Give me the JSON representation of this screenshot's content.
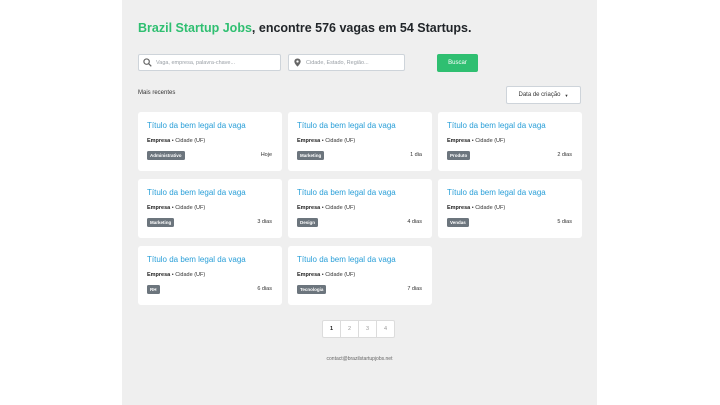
{
  "header": {
    "brand": "Brazil Startup Jobs",
    "tagline": ", encontre 576 vagas em 54 Startups."
  },
  "search": {
    "keyword_placeholder": "Vaga, empresa, palavra-chave...",
    "keyword_value": "",
    "location_placeholder": "Cidade, Estado, Região...",
    "location_value": "",
    "button_label": "Buscar"
  },
  "listing": {
    "section_label": "Mais recentes",
    "sort_label": "Data de criação",
    "jobs": [
      {
        "title": "Título da bem legal da vaga",
        "company": "Empresa",
        "location": " • Cidade (UF)",
        "tag": "Administrativo",
        "posted": "Hoje"
      },
      {
        "title": "Título da bem legal da vaga",
        "company": "Empresa",
        "location": " • Cidade (UF)",
        "tag": "Marketing",
        "posted": "1 dia"
      },
      {
        "title": "Título da bem legal da vaga",
        "company": "Empresa",
        "location": " • Cidade (UF)",
        "tag": "Produto",
        "posted": "2 dias"
      },
      {
        "title": "Título da bem legal da vaga",
        "company": "Empresa",
        "location": " • Cidade (UF)",
        "tag": "Marketing",
        "posted": "3 dias"
      },
      {
        "title": "Título da bem legal da vaga",
        "company": "Empresa",
        "location": " • Cidade (UF)",
        "tag": "Design",
        "posted": "4 dias"
      },
      {
        "title": "Título da bem legal da vaga",
        "company": "Empresa",
        "location": " • Cidade (UF)",
        "tag": "Vendas",
        "posted": "5 dias"
      },
      {
        "title": "Título da bem legal da vaga",
        "company": "Empresa",
        "location": " • Cidade (UF)",
        "tag": "RH",
        "posted": "6 dias"
      },
      {
        "title": "Título da bem legal da vaga",
        "company": "Empresa",
        "location": " • Cidade (UF)",
        "tag": "Tecnologia",
        "posted": "7 dias"
      }
    ]
  },
  "pagination": {
    "pages": [
      "1",
      "2",
      "3",
      "4"
    ],
    "current": "1"
  },
  "footer": {
    "email": "contact@brazilstartupjobs.net"
  },
  "colors": {
    "brand": "#2fbf71",
    "link": "#2a9fd8",
    "tag_bg": "#6c757d",
    "page_bg": "#efefef"
  },
  "icons": {
    "keyword_field": "search-icon",
    "location_field": "map-pin-icon",
    "sort": "caret-down-icon"
  }
}
